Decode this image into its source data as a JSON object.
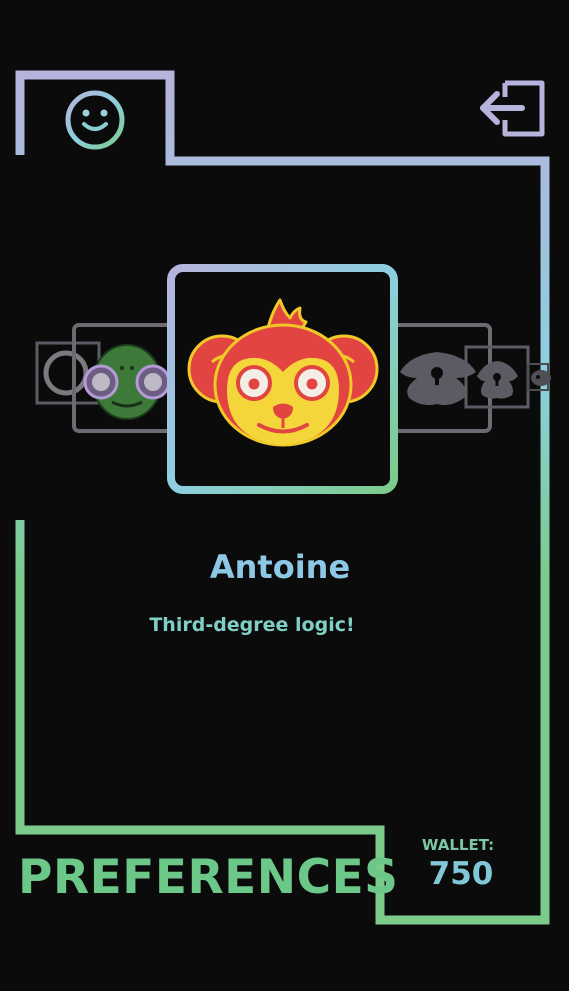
{
  "colors": {
    "background": "#0b0b0b",
    "lavender": "#b6b3dc",
    "sky": "#8dcfe0",
    "mint": "#7ccb8b",
    "name_text": "#8dc9e6",
    "tagline_text": "#7fcfc6",
    "title_text": "#6cc889",
    "wallet_label_text": "#7cc7a6",
    "wallet_value_text": "#82c7d8",
    "locked_gray": "#6d6b73"
  },
  "header": {
    "profile_icon": "smiley-icon",
    "exit_icon": "exit-icon"
  },
  "carousel": {
    "selected": {
      "name": "Antoine",
      "tagline": "Third-degree logic!",
      "icon": "monkey-avatar"
    },
    "items": [
      {
        "icon": "ring-avatar",
        "locked": false
      },
      {
        "icon": "frog-avatar",
        "locked": false
      },
      {
        "icon": "monkey-avatar",
        "locked": false
      },
      {
        "icon": "lock-icon",
        "locked": true
      },
      {
        "icon": "lock-icon",
        "locked": true
      },
      {
        "icon": "lock-icon",
        "locked": true
      }
    ]
  },
  "footer": {
    "title": "PREFERENCES",
    "wallet_label": "WALLET:",
    "wallet_value": "750"
  }
}
